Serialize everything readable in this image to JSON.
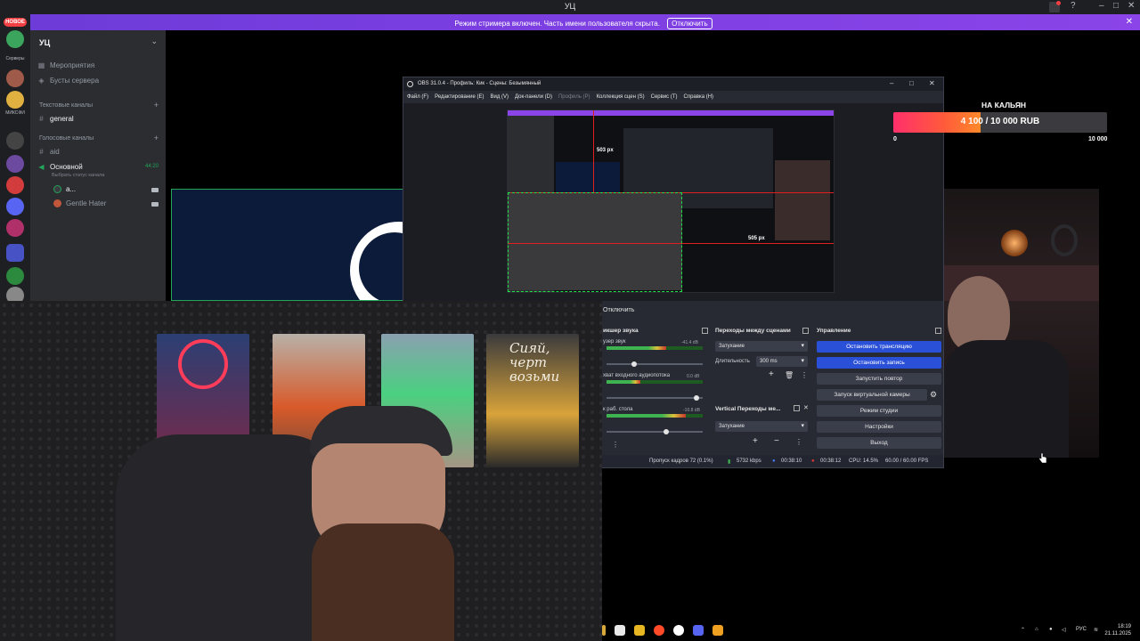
{
  "window": {
    "title": "УЦ"
  },
  "banner": {
    "text": "Режим стримера включен. Часть имени пользователя скрыта.",
    "button": "Отключить"
  },
  "rail": {
    "new_badge": "НОВОЕ",
    "servers_label": "Серверы",
    "friends_label": "МИКСФИ"
  },
  "sidebar": {
    "server_name": "УЦ",
    "items": [
      {
        "icon": "calendar-icon",
        "label": "Мероприятия"
      },
      {
        "icon": "rocket-icon",
        "label": "Бусты сервера"
      }
    ],
    "text_category": "Текстовые каналы",
    "text_channels": [
      {
        "label": "general"
      }
    ],
    "voice_category": "Голосовые каналы",
    "voice_channels": [
      {
        "label": "aid"
      },
      {
        "label": "Основной",
        "status": "Выбрать статус канала",
        "time": "44:20"
      }
    ],
    "voice_users": [
      {
        "label": "a..."
      },
      {
        "label": "Gentle Hater"
      }
    ]
  },
  "obs": {
    "title": "OBS 31.0.4 - Профиль: Кик - Сцены: Безымянный",
    "menu": [
      "Файл (F)",
      "Редактирование (E)",
      "Вид (V)",
      "Док-панели (D)",
      "Профиль (P)",
      "Коллекция сцен (S)",
      "Сервис (T)",
      "Справка (H)"
    ],
    "preview_labels": {
      "top": "503 px",
      "bottom": "505 px"
    },
    "disconnect": "Отключить",
    "mixer": {
      "title": "икшер звука",
      "channels": [
        {
          "label": "узер звук",
          "db": "-41.4 dB",
          "level": 0.62
        },
        {
          "label": "хват входного аудиопотока",
          "db": "0.0 dB",
          "level": 0.35
        },
        {
          "label": "к раб. стола",
          "db": "-10.8 dB",
          "level": 0.82
        }
      ]
    },
    "transitions": {
      "title": "Переходы между сценами",
      "selected": "Затухание",
      "duration_label": "Длительность",
      "duration_value": "300 ms"
    },
    "vertical_transitions": {
      "title": "Vertical Переходы ме...",
      "selected": "Затухание"
    },
    "controls": {
      "title": "Управление",
      "buttons": [
        "Остановить трансляцию",
        "Остановить запись",
        "Запустить повтор",
        "Запуск виртуальной камеры",
        "Режим студии",
        "Настройки",
        "Выход"
      ]
    },
    "status": {
      "dropped": "Пропуск кадров 72 (0.1%)",
      "bitrate": "5732 kbps",
      "stream_time": "00:38:10",
      "rec_time": "00:38:12",
      "cpu": "CPU: 14.5%",
      "fps": "60.00 / 60.00 FPS"
    }
  },
  "donation": {
    "title": "НА КАЛЬЯН",
    "progress_text": "4 100 / 10 000 RUB",
    "current": 4100,
    "goal": 10000,
    "min_label": "0",
    "max_label": "10 000"
  },
  "posters": {
    "text": "Сияй, черт возьми"
  },
  "taskbar": {
    "lang": "РУС",
    "time": "18:19",
    "date": "21.11.2025"
  },
  "colors": {
    "banner": "#7a3ee0",
    "obs_active": "#2b50d8",
    "discord_green": "#23a55a",
    "donation": "#ff2f6b"
  }
}
